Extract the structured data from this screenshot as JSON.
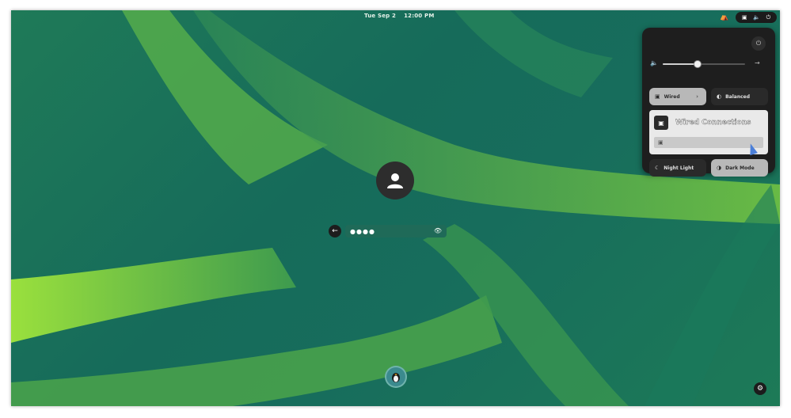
{
  "topbar": {
    "day": "Tue Sep 2",
    "time": "12:00 PM",
    "accessibility_icon": "accessibility-icon",
    "network_icon": "wired-network-icon",
    "volume_icon": "speaker-icon",
    "power_icon": "power-icon"
  },
  "login": {
    "message": "",
    "username": "",
    "password_mask": "●●●●",
    "back_icon": "arrow-left-icon",
    "reveal_icon": "eye-icon"
  },
  "quick_settings": {
    "power_icon": "power-icon",
    "volume": {
      "level": 0.42,
      "icon": "speaker-icon",
      "arrow_icon": "arrow-right-icon"
    },
    "wired_label": "Wired",
    "balanced_label": "Balanced",
    "network_menu": {
      "title": "Wired Connections",
      "item_label": ""
    },
    "night_light_label": "Night Light",
    "dark_mode_label": "Dark Mode"
  },
  "colors": {
    "wallpaper_base": "#176d5c",
    "wallpaper_accent": "#8fe040",
    "panel_bg": "#1e1e1e"
  }
}
